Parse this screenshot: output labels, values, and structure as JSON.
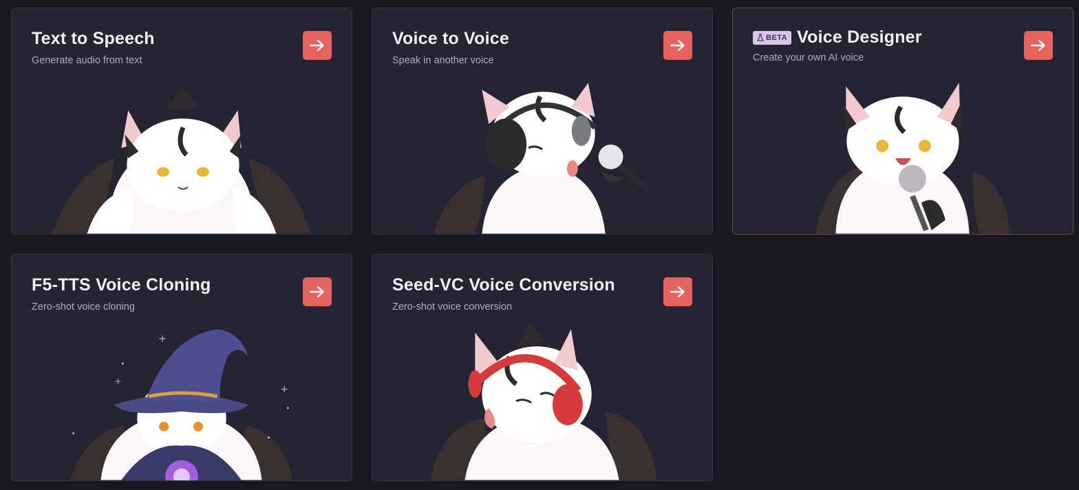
{
  "cards": [
    {
      "title": "Text to Speech",
      "subtitle": "Generate audio from text",
      "button_icon": "arrow-right-icon",
      "illustration": "fox-character"
    },
    {
      "title": "Voice to Voice",
      "subtitle": "Speak in another voice",
      "button_icon": "arrow-right-icon",
      "illustration": "fox-with-headphones-and-microphone"
    },
    {
      "title": "Voice Designer",
      "subtitle": "Create your own AI voice",
      "badge": "BETA",
      "badge_icon": "flask-icon",
      "button_icon": "arrow-right-icon",
      "illustration": "fox-singing-with-microphone"
    },
    {
      "title": "F5-TTS Voice Cloning",
      "subtitle": "Zero-shot voice cloning",
      "button_icon": "arrow-right-icon",
      "illustration": "fox-wizard-with-crystal-ball"
    },
    {
      "title": "Seed-VC Voice Conversion",
      "subtitle": "Zero-shot voice conversion",
      "button_icon": "arrow-right-icon",
      "illustration": "fox-with-red-headphones"
    }
  ],
  "colors": {
    "page_bg": "#191922",
    "card_bg": "#242433",
    "accent": "#e6625e",
    "beta_bg": "#d9c6e6"
  }
}
